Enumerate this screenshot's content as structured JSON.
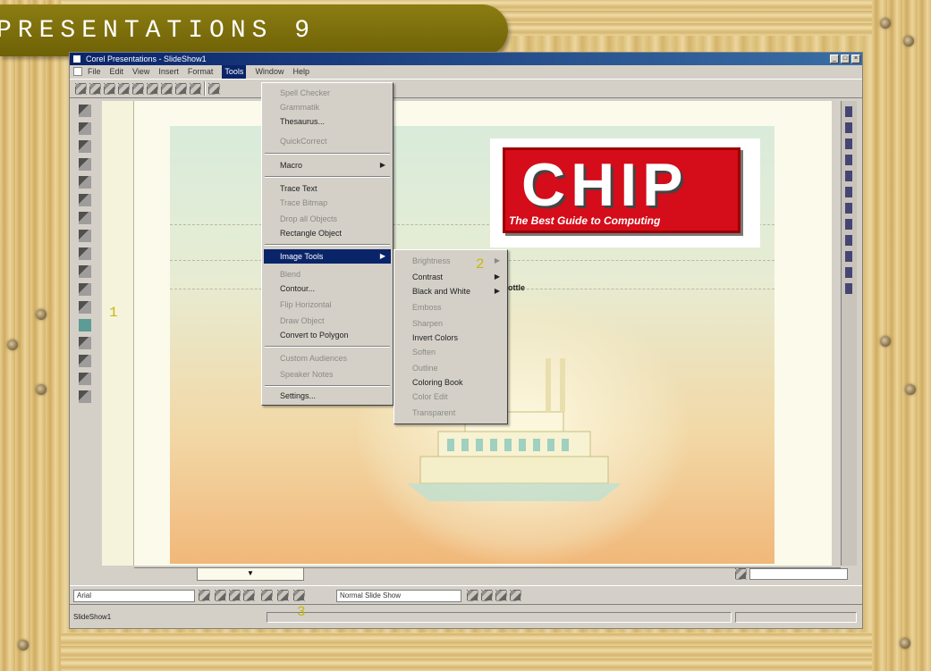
{
  "header": {
    "title": "PRESENTATIONS 9"
  },
  "window": {
    "title": "Corel Presentations - SlideShow1",
    "buttons": [
      "_",
      "□",
      "×"
    ]
  },
  "menubar": {
    "items": [
      "File",
      "Edit",
      "View",
      "Insert",
      "Format",
      "Tools",
      "Window",
      "Help"
    ]
  },
  "tools_menu": {
    "items": [
      {
        "label": "Spell Checker",
        "state": "dim"
      },
      {
        "label": "Grammatik",
        "state": "dim"
      },
      {
        "label": "Thesaurus...",
        "state": "normal"
      },
      {
        "label": "QuickCorrect",
        "state": "dim"
      },
      {
        "label": "Macro",
        "state": "normal",
        "submenu": true
      },
      {
        "label": "Trace Text",
        "state": "normal"
      },
      {
        "label": "Trace Bitmap",
        "state": "dim"
      },
      {
        "label": "Drop all Objects",
        "state": "dim"
      },
      {
        "label": "Rectangle Object",
        "state": "normal"
      },
      {
        "label": "Image Tools",
        "state": "highlight",
        "submenu": true
      },
      {
        "label": "Blend",
        "state": "dim"
      },
      {
        "label": "Contour...",
        "state": "normal"
      },
      {
        "label": "Flip Horizontal",
        "state": "dim"
      },
      {
        "label": "Draw Object",
        "state": "dim"
      },
      {
        "label": "Convert to Polygon",
        "state": "normal"
      },
      {
        "label": "Custom Audiences",
        "state": "dim"
      },
      {
        "label": "Speaker Notes",
        "state": "dim"
      },
      {
        "label": "Settings...",
        "state": "normal"
      }
    ]
  },
  "image_tools_submenu": {
    "items": [
      {
        "label": "Brightness",
        "state": "dim",
        "submenu": true
      },
      {
        "label": "Contrast",
        "state": "normal",
        "submenu": true
      },
      {
        "label": "Black and White",
        "state": "normal",
        "submenu": true
      },
      {
        "label": "Emboss",
        "state": "dim"
      },
      {
        "label": "Sharpen",
        "state": "dim"
      },
      {
        "label": "Invert Colors",
        "state": "normal"
      },
      {
        "label": "Soften",
        "state": "dim"
      },
      {
        "label": "Outline",
        "state": "dim"
      },
      {
        "label": "Coloring Book",
        "state": "normal"
      },
      {
        "label": "Color Edit",
        "state": "dim"
      },
      {
        "label": "Transparent",
        "state": "dim"
      }
    ]
  },
  "slide": {
    "logo_word": "CHIP",
    "logo_tagline": "The Best Guide to Computing",
    "subtitle_fragment": "ottle"
  },
  "zoom": {
    "value": ""
  },
  "propbar": {
    "font": "Arial",
    "style": "Normal Slide Show"
  },
  "status": {
    "text": "SlideShow1"
  },
  "callouts": {
    "one": "1",
    "two": "2",
    "three": "3"
  },
  "colors": {
    "accent": "#0a246a",
    "logo_red": "#d50c1a",
    "header_band": "#7a6c0a",
    "callout": "#c7b80c"
  }
}
